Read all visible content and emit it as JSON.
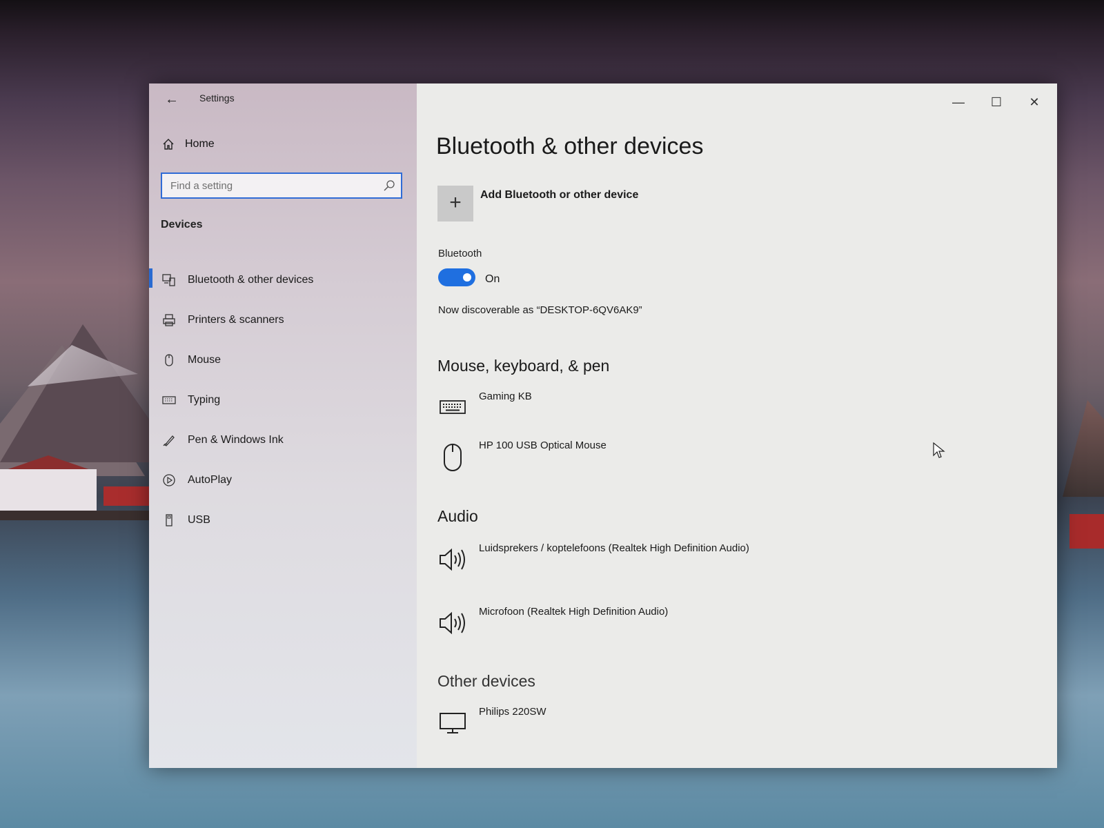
{
  "window": {
    "title": "Settings",
    "controls": {
      "minimize": "—",
      "maximize": "☐",
      "close": "✕"
    }
  },
  "sidebar": {
    "home_label": "Home",
    "search": {
      "placeholder": "Find a setting"
    },
    "section_title": "Devices",
    "items": [
      {
        "label": "Bluetooth & other devices",
        "icon": "bluetooth-devices-icon",
        "active": true
      },
      {
        "label": "Printers & scanners",
        "icon": "printer-icon",
        "active": false
      },
      {
        "label": "Mouse",
        "icon": "mouse-icon",
        "active": false
      },
      {
        "label": "Typing",
        "icon": "keyboard-icon",
        "active": false
      },
      {
        "label": "Pen & Windows Ink",
        "icon": "pen-icon",
        "active": false
      },
      {
        "label": "AutoPlay",
        "icon": "autoplay-icon",
        "active": false
      },
      {
        "label": "USB",
        "icon": "usb-icon",
        "active": false
      }
    ]
  },
  "main": {
    "title": "Bluetooth & other devices",
    "add_device_label": "Add Bluetooth or other device",
    "bluetooth": {
      "label": "Bluetooth",
      "state": "On",
      "enabled": true,
      "discoverable_text": "Now discoverable as “DESKTOP-6QV6AK9”"
    },
    "sections": {
      "input_title": "Mouse, keyboard, & pen",
      "audio_title": "Audio",
      "other_title": "Other devices"
    },
    "devices": {
      "keyboard": "Gaming KB",
      "mouse": "HP 100 USB Optical Mouse",
      "speakers": "Luidsprekers / koptelefoons (Realtek High Definition Audio)",
      "microphone": "Microfoon (Realtek High Definition Audio)",
      "monitor": "Philips 220SW"
    }
  },
  "colors": {
    "accent": "#1f6fe0",
    "sidebar_active_bar": "#2a6bd1",
    "content_bg": "#ebebe9"
  }
}
